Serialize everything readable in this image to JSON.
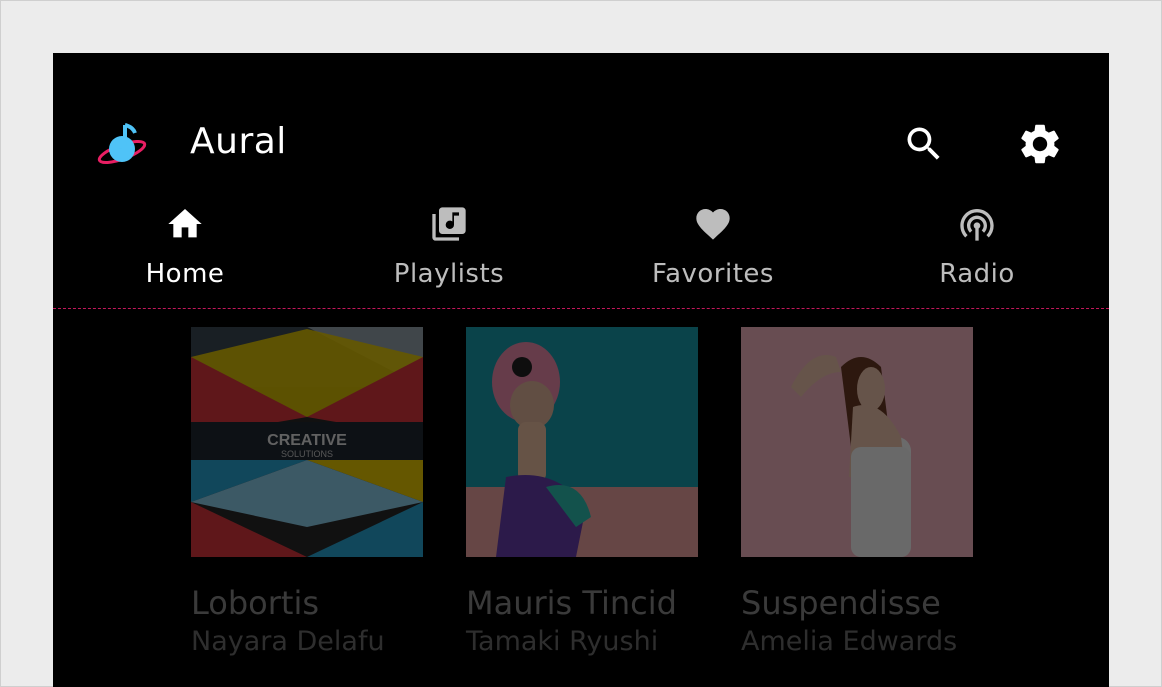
{
  "app": {
    "title": "Aural"
  },
  "actions": {
    "search": "search-icon",
    "settings": "gear-icon"
  },
  "tabs": [
    {
      "label": "Home",
      "icon": "home-icon",
      "active": true
    },
    {
      "label": "Playlists",
      "icon": "library-music-icon",
      "active": false
    },
    {
      "label": "Favorites",
      "icon": "heart-icon",
      "active": false
    },
    {
      "label": "Radio",
      "icon": "radio-icon",
      "active": false
    }
  ],
  "albums": [
    {
      "title": "Lobortis",
      "artist": "Nayara Delafu",
      "cover_text": [
        "CREATIVE",
        "SOLUTIONS"
      ]
    },
    {
      "title": "Mauris Tincid",
      "artist": "Tamaki Ryushi"
    },
    {
      "title": "Suspendisse",
      "artist": "Amelia Edwards"
    }
  ],
  "colors": {
    "background": "#000000",
    "divider": "#c2185b",
    "accent_cyan": "#4fc3f7",
    "accent_pink": "#e91e63"
  }
}
